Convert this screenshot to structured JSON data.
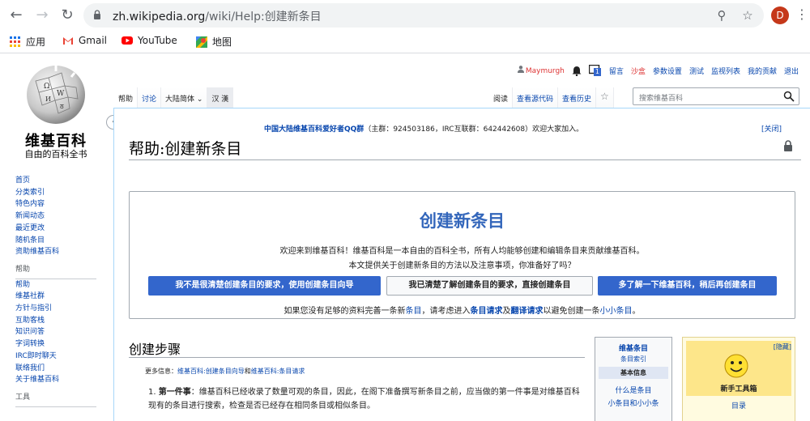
{
  "browser": {
    "url_host": "zh.wikipedia.org",
    "url_path": "/wiki/Help:创建新条目",
    "profile_initial": "D",
    "bookmarks": [
      {
        "label": "应用",
        "icon": "apps-grid-icon"
      },
      {
        "label": "Gmail",
        "icon": "gmail-icon"
      },
      {
        "label": "YouTube",
        "icon": "youtube-icon"
      },
      {
        "label": "地图",
        "icon": "maps-icon"
      }
    ]
  },
  "wiki": {
    "logo_name": "维基百科",
    "logo_tagline": "自由的百科全书",
    "personal": {
      "username": "Maymurgh",
      "notice_count": "1",
      "items": [
        "留言",
        "沙盒",
        "参数设置",
        "测试",
        "监视列表",
        "我的贡献",
        "退出"
      ]
    },
    "tabs_left": [
      {
        "label": "帮助",
        "state": "selected"
      },
      {
        "label": "讨论",
        "state": "link"
      },
      {
        "label": "大陆简体 ⌄",
        "state": "variant"
      },
      {
        "label": "汉 漢",
        "state": "hanzi"
      }
    ],
    "tabs_right": [
      "阅读",
      "查看源代码",
      "查看历史"
    ],
    "search_placeholder": "搜索维基百科",
    "sidebar": {
      "nav": [
        "首页",
        "分类索引",
        "特色内容",
        "新闻动态",
        "最近更改",
        "随机条目",
        "资助维基百科"
      ],
      "help_heading": "帮助",
      "help_links": [
        "帮助",
        "维基社群",
        "方针与指引",
        "互助客栈",
        "知识问答",
        "字词转换",
        "IRC即时聊天",
        "联络我们",
        "关于维基百科"
      ],
      "tools_heading": "工具"
    },
    "sitenotice": {
      "link": "中国大陆维基百科爱好者QQ群",
      "text": "（主群：924503186，IRC互联群：642442608）欢迎大家加入。",
      "close": "[关闭]"
    },
    "page_title": "帮助:创建新条目",
    "intro": {
      "heading": "创建新条目",
      "line1": "欢迎来到维基百科！维基百科是一本自由的百科全书，所有人均能够创建和编辑条目来贡献维基百科。",
      "line2": "本文提供关于创建新条目的方法以及注意事项，你准备好了吗？",
      "btn1": "我不是很清楚创建条目的要求，使用创建条目向导",
      "btn2": "我已清楚了解创建条目的要求，直接创建条目",
      "btn3": "多了解一下维基百科，稍后再创建条目",
      "line3_a": "如果您没有足够的资料完善一条新",
      "line3_link1": "条目",
      "line3_b": "，请考虑进入",
      "line3_link2": "条目请求",
      "line3_c": "及",
      "line3_link3": "翻译请求",
      "line3_d": "以避免创建一条",
      "line3_link4": "小小条目",
      "line3_e": "。"
    },
    "section": {
      "heading": "创建步骤",
      "more_info_label": "更多信息：",
      "more_info_link1": "维基百科:创建条目向导",
      "more_info_and": "和",
      "more_info_link2": "维基百科:条目请求",
      "step1_num": "1.",
      "step1_bold": "第一件事",
      "step1_text": "：维基百科已经收录了数量可观的条目，因此，在阁下准备撰写新条目之前，应当做的第一件事是对维基百科现有的条目进行搜索，检查是否已经存在相同条目或相似条目。"
    },
    "navbox": {
      "title": "维基条目",
      "subtitle": "条目索引",
      "header": "基本信息",
      "link1": "什么是条目",
      "link2": "小条目和小小条"
    },
    "toolbox": {
      "hide": "[隐藏]",
      "title": "新手工具箱",
      "link": "目录"
    }
  }
}
